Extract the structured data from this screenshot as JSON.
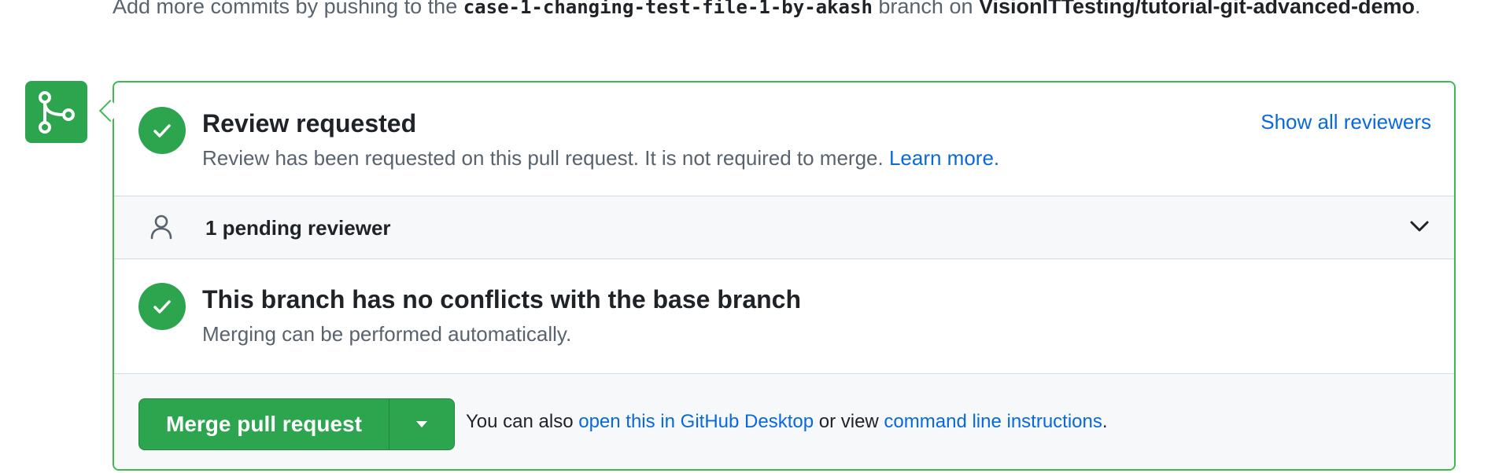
{
  "top_note": {
    "prefix": "Add more commits by pushing to the ",
    "branch": "case-1-changing-test-file-1-by-akash",
    "middle": " branch on ",
    "repo": "VisionITTesting/tutorial-git-advanced-demo",
    "suffix": "."
  },
  "review": {
    "title": "Review requested",
    "description": "Review has been requested on this pull request. It is not required to merge.",
    "learn_more": "Learn more.",
    "show_all": "Show all reviewers"
  },
  "pending": {
    "label": "1 pending reviewer"
  },
  "conflicts": {
    "title": "This branch has no conflicts with the base branch",
    "description": "Merging can be performed automatically."
  },
  "merge": {
    "button_label": "Merge pull request",
    "hint_prefix": "You can also ",
    "hint_desktop_link": "open this in GitHub Desktop",
    "hint_middle": " or view ",
    "hint_cli_link": "command line instructions",
    "hint_suffix": "."
  },
  "colors": {
    "success": "#2da44e",
    "success_border": "#3fb950",
    "link": "#0969da",
    "muted": "#59636e",
    "text": "#1f2328",
    "subtle_bg": "#f6f8fa"
  },
  "icons": {
    "merge_tile": "git-merge-icon",
    "review_status": "check-circle-icon",
    "pending": "person-icon",
    "toggle": "chevron-down-icon",
    "conflicts_status": "check-circle-icon",
    "dropdown": "triangle-down-icon"
  }
}
